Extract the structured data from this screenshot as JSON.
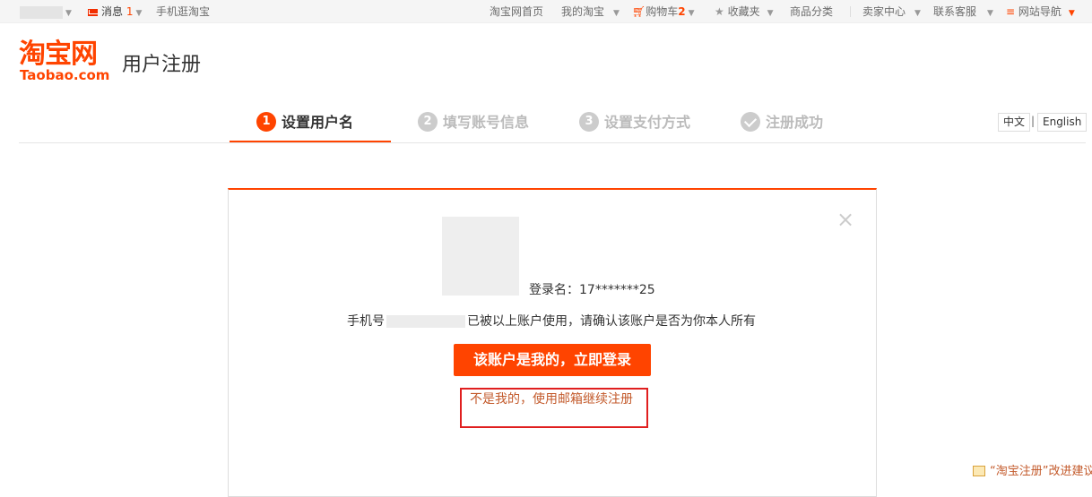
{
  "topbar": {
    "messages_label": "消息",
    "messages_count": "1",
    "mobile_label": "手机逛淘宝",
    "home_label": "淘宝网首页",
    "my_taobao_label": "我的淘宝",
    "cart_label": "购物车",
    "cart_count": "2",
    "favorites_label": "收藏夹",
    "categories_label": "商品分类",
    "seller_center_label": "卖家中心",
    "support_label": "联系客服",
    "site_nav_label": "网站导航"
  },
  "header": {
    "logo_cn": "淘宝网",
    "logo_en": "Taobao.com",
    "title": "用户注册"
  },
  "steps": [
    {
      "num": "1",
      "label": "设置用户名",
      "active": true
    },
    {
      "num": "2",
      "label": "填写账号信息",
      "active": false
    },
    {
      "num": "3",
      "label": "设置支付方式",
      "active": false
    },
    {
      "num": "",
      "label": "注册成功",
      "active": false
    }
  ],
  "language": {
    "zh": "中文",
    "sep": "|",
    "en": "English"
  },
  "dialog": {
    "close_glyph": "×",
    "login_name": "登录名：17*******25",
    "phone_prefix": "手机号",
    "phone_suffix": "已被以上账户使用，请确认该账户是否为你本人所有",
    "confirm_button": "该账户是我的，立即登录",
    "not_mine_link": "不是我的，使用邮箱继续注册"
  },
  "feedback": "“淘宝注册”改进建议",
  "colors": {
    "accent": "#ff4400",
    "highlight_box": "#e01f1f"
  }
}
